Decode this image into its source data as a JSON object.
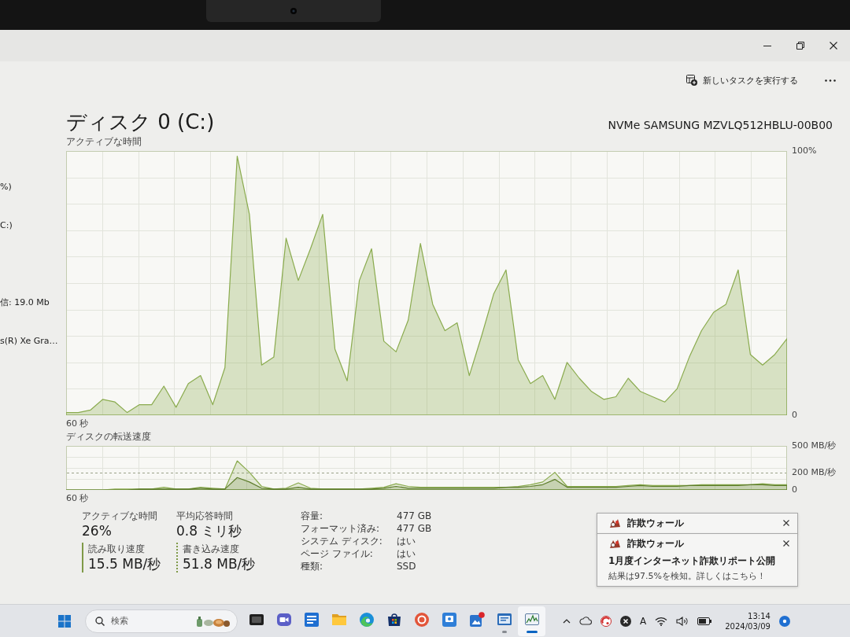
{
  "sidebar": {
    "items": [
      {
        "text": "%)"
      },
      {
        "text": "C:)"
      },
      {
        "text": "信: 19.0 Mb"
      },
      {
        "text": "s(R) Xe Gra…"
      }
    ]
  },
  "command_bar": {
    "run_new_task": "新しいタスクを実行する"
  },
  "header": {
    "title": "ディスク 0 (C:)",
    "model": "NVMe SAMSUNG MZVLQ512HBLU-00B00"
  },
  "active_time": {
    "chart_data": {
      "type": "area",
      "title": "アクティブな時間",
      "xlabel": "60 秒",
      "grid": true,
      "ylim": [
        0,
        100
      ],
      "yticks": [
        {
          "value": 0,
          "label": "0"
        },
        {
          "value": 100,
          "label": "100%"
        }
      ],
      "series": [
        {
          "color": "#8aab4e",
          "values": [
            1,
            1,
            2,
            6,
            5,
            1,
            4,
            4,
            11,
            3,
            12,
            15,
            4,
            18,
            98,
            76,
            19,
            22,
            67,
            51,
            63,
            76,
            25,
            13,
            51,
            63,
            28,
            24,
            36,
            65,
            42,
            32,
            35,
            15,
            30,
            46,
            55,
            21,
            12,
            15,
            6,
            20,
            14,
            9,
            6,
            7,
            14,
            9,
            7,
            5,
            10,
            22,
            32,
            39,
            42,
            55,
            23,
            19,
            23,
            29
          ]
        }
      ]
    }
  },
  "transfer_rate": {
    "chart_data": {
      "type": "area",
      "title": "ディスクの転送速度",
      "xlabel": "60 秒",
      "grid": true,
      "ylim": [
        0,
        500
      ],
      "yticks": [
        {
          "value": 0,
          "label": "0"
        },
        {
          "value": 500,
          "label": "500 MB/秒"
        }
      ],
      "ref_lines": [
        {
          "axis": "y",
          "value": 200,
          "label": "200 MB/秒"
        }
      ],
      "series": [
        {
          "color": "#8aab4e",
          "values": [
            0,
            0,
            0,
            0,
            10,
            10,
            10,
            10,
            30,
            10,
            10,
            30,
            20,
            10,
            330,
            200,
            40,
            10,
            20,
            80,
            20,
            10,
            10,
            10,
            10,
            20,
            30,
            70,
            40,
            30,
            30,
            30,
            30,
            30,
            30,
            30,
            30,
            40,
            60,
            90,
            200,
            40,
            40,
            40,
            40,
            40,
            50,
            60,
            50,
            50,
            50,
            50,
            60,
            60,
            60,
            60,
            60,
            70,
            60,
            60
          ]
        },
        {
          "color": "#5e7d2c",
          "values": [
            0,
            0,
            0,
            0,
            0,
            0,
            10,
            10,
            10,
            10,
            10,
            20,
            10,
            10,
            140,
            90,
            20,
            10,
            10,
            30,
            10,
            10,
            10,
            10,
            10,
            10,
            20,
            40,
            20,
            20,
            20,
            20,
            20,
            20,
            20,
            20,
            30,
            30,
            40,
            60,
            120,
            30,
            30,
            30,
            30,
            30,
            40,
            50,
            40,
            40,
            40,
            50,
            50,
            50,
            50,
            50,
            60,
            60,
            50,
            50
          ]
        }
      ]
    }
  },
  "stats": [
    {
      "kind": "plain",
      "label": "アクティブな時間",
      "value": "26%"
    },
    {
      "kind": "plain",
      "label": "平均応答時間",
      "value": "0.8 ミリ秒"
    },
    {
      "kind": "solid",
      "label": "読み取り速度",
      "value": "15.5 MB/秒"
    },
    {
      "kind": "dashed",
      "label": "書き込み速度",
      "value": "51.8 MB/秒"
    }
  ],
  "properties": [
    {
      "label": "容量:",
      "value": "477 GB"
    },
    {
      "label": "フォーマット済み:",
      "value": "477 GB"
    },
    {
      "label": "システム ディスク:",
      "value": "はい"
    },
    {
      "label": "ページ ファイル:",
      "value": "はい"
    },
    {
      "label": "種類:",
      "value": "SSD"
    }
  ],
  "notifications": [
    {
      "app": "詐欺ウォール"
    },
    {
      "app": "詐欺ウォール",
      "title": "1月度インターネット詐欺リポート公開",
      "body": "結果は97.5%を検知。詳しくはこちら！"
    }
  ],
  "taskbar": {
    "search": {
      "placeholder": "検索"
    },
    "apps": [
      {
        "kind": "task-view",
        "running": false,
        "selected": false
      },
      {
        "kind": "chat",
        "running": false,
        "selected": false
      },
      {
        "kind": "list-tile",
        "running": false,
        "selected": false
      },
      {
        "kind": "folder",
        "running": false,
        "selected": false
      },
      {
        "kind": "browser",
        "running": false,
        "selected": false
      },
      {
        "kind": "store",
        "running": false,
        "selected": false
      },
      {
        "kind": "ring",
        "running": false,
        "selected": false
      },
      {
        "kind": "tile",
        "running": false,
        "selected": false
      },
      {
        "kind": "picture",
        "running": false,
        "selected": false
      },
      {
        "kind": "window",
        "running": true,
        "selected": false
      },
      {
        "kind": "graph",
        "running": true,
        "selected": true
      }
    ],
    "ime": "A",
    "time": "13:14",
    "date": "2024/03/09"
  }
}
